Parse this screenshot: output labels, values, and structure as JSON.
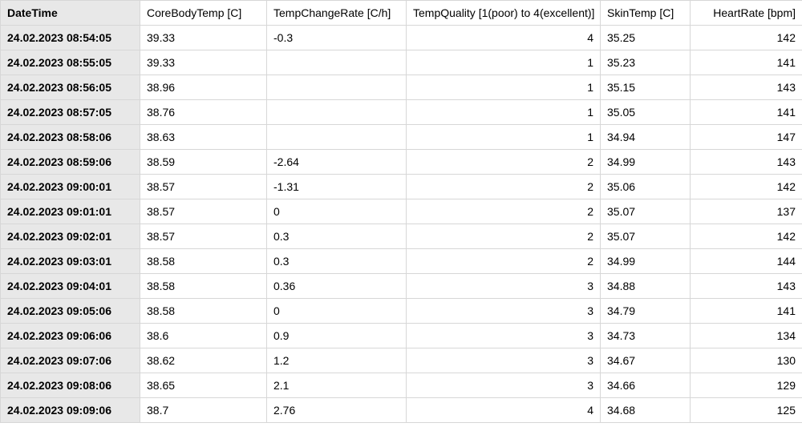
{
  "headers": {
    "datetime": "DateTime",
    "corebody": "CoreBodyTemp [C]",
    "rate": "TempChangeRate [C/h]",
    "quality": "TempQuality [1(poor) to 4(excellent)]",
    "skin": "SkinTemp [C]",
    "hr": "HeartRate [bpm]"
  },
  "rows": [
    {
      "datetime": "24.02.2023 08:54:05",
      "corebody": "39.33",
      "rate": "-0.3",
      "quality": "4",
      "skin": "35.25",
      "hr": "142"
    },
    {
      "datetime": "24.02.2023 08:55:05",
      "corebody": "39.33",
      "rate": "",
      "quality": "1",
      "skin": "35.23",
      "hr": "141"
    },
    {
      "datetime": "24.02.2023 08:56:05",
      "corebody": "38.96",
      "rate": "",
      "quality": "1",
      "skin": "35.15",
      "hr": "143"
    },
    {
      "datetime": "24.02.2023 08:57:05",
      "corebody": "38.76",
      "rate": "",
      "quality": "1",
      "skin": "35.05",
      "hr": "141"
    },
    {
      "datetime": "24.02.2023 08:58:06",
      "corebody": "38.63",
      "rate": "",
      "quality": "1",
      "skin": "34.94",
      "hr": "147"
    },
    {
      "datetime": "24.02.2023 08:59:06",
      "corebody": "38.59",
      "rate": "-2.64",
      "quality": "2",
      "skin": "34.99",
      "hr": "143"
    },
    {
      "datetime": "24.02.2023 09:00:01",
      "corebody": "38.57",
      "rate": "-1.31",
      "quality": "2",
      "skin": "35.06",
      "hr": "142"
    },
    {
      "datetime": "24.02.2023 09:01:01",
      "corebody": "38.57",
      "rate": "0",
      "quality": "2",
      "skin": "35.07",
      "hr": "137"
    },
    {
      "datetime": "24.02.2023 09:02:01",
      "corebody": "38.57",
      "rate": "0.3",
      "quality": "2",
      "skin": "35.07",
      "hr": "142"
    },
    {
      "datetime": "24.02.2023 09:03:01",
      "corebody": "38.58",
      "rate": "0.3",
      "quality": "2",
      "skin": "34.99",
      "hr": "144"
    },
    {
      "datetime": "24.02.2023 09:04:01",
      "corebody": "38.58",
      "rate": "0.36",
      "quality": "3",
      "skin": "34.88",
      "hr": "143"
    },
    {
      "datetime": "24.02.2023 09:05:06",
      "corebody": "38.58",
      "rate": "0",
      "quality": "3",
      "skin": "34.79",
      "hr": "141"
    },
    {
      "datetime": "24.02.2023 09:06:06",
      "corebody": "38.6",
      "rate": "0.9",
      "quality": "3",
      "skin": "34.73",
      "hr": "134"
    },
    {
      "datetime": "24.02.2023 09:07:06",
      "corebody": "38.62",
      "rate": "1.2",
      "quality": "3",
      "skin": "34.67",
      "hr": "130"
    },
    {
      "datetime": "24.02.2023 09:08:06",
      "corebody": "38.65",
      "rate": "2.1",
      "quality": "3",
      "skin": "34.66",
      "hr": "129"
    },
    {
      "datetime": "24.02.2023 09:09:06",
      "corebody": "38.7",
      "rate": "2.76",
      "quality": "4",
      "skin": "34.68",
      "hr": "125"
    }
  ]
}
